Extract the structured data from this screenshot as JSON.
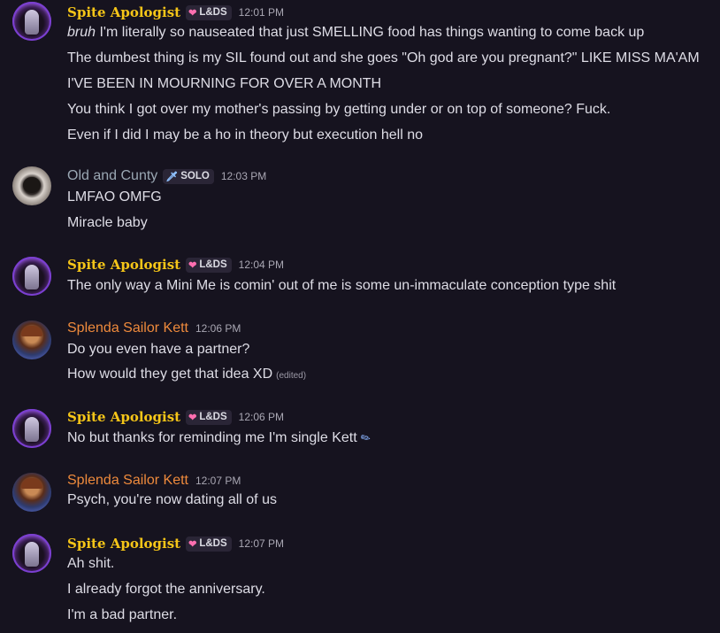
{
  "messages": [
    {
      "author": "Spite Apologist",
      "badge": "L&DS",
      "badge_icon": "heart-icon",
      "time": "12:01 PM",
      "lines": [
        "I'm literally so nauseated that just SMELLING food has things wanting to come back up",
        "The dumbest thing is my SIL found out and she goes \"Oh god are you pregnant?\" LIKE MISS MA'AM",
        "I'VE BEEN IN MOURNING FOR OVER A MONTH",
        "You think I got over my mother's passing by getting under or on top of someone? Fuck.",
        "Even if I did I may be a ho in theory but execution hell no"
      ],
      "first_line_prefix": "bruh"
    },
    {
      "author": "Old and Cunty",
      "badge": "SOLO",
      "badge_icon": "sword-icon",
      "time": "12:03 PM",
      "lines": [
        "LMFAO OMFG",
        "Miracle baby"
      ]
    },
    {
      "author": "Spite Apologist",
      "badge": "L&DS",
      "badge_icon": "heart-icon",
      "time": "12:04 PM",
      "lines": [
        "The only way a Mini Me is comin' out of me is some un-immaculate conception type shit"
      ]
    },
    {
      "author": "Splenda Sailor Kett",
      "time": "12:06 PM",
      "lines": [
        "Do you even have a partner?",
        "How would they get that idea XD"
      ],
      "edited_label": "(edited)"
    },
    {
      "author": "Spite Apologist",
      "badge": "L&DS",
      "badge_icon": "heart-icon",
      "time": "12:06 PM",
      "lines": [
        "No but thanks for reminding me I'm single Kett"
      ]
    },
    {
      "author": "Splenda Sailor Kett",
      "time": "12:07 PM",
      "lines": [
        "Psych, you're now dating all of us"
      ]
    },
    {
      "author": "Spite Apologist",
      "badge": "L&DS",
      "badge_icon": "heart-icon",
      "time": "12:07 PM",
      "lines": [
        "Ah shit.",
        "I already forgot the anniversary.",
        "I'm a bad partner."
      ]
    }
  ],
  "colors": {
    "background": "#16131f",
    "spite_name": "#f5c518",
    "old_name": "#9aa7b3",
    "kett_name": "#ee8a3c"
  }
}
